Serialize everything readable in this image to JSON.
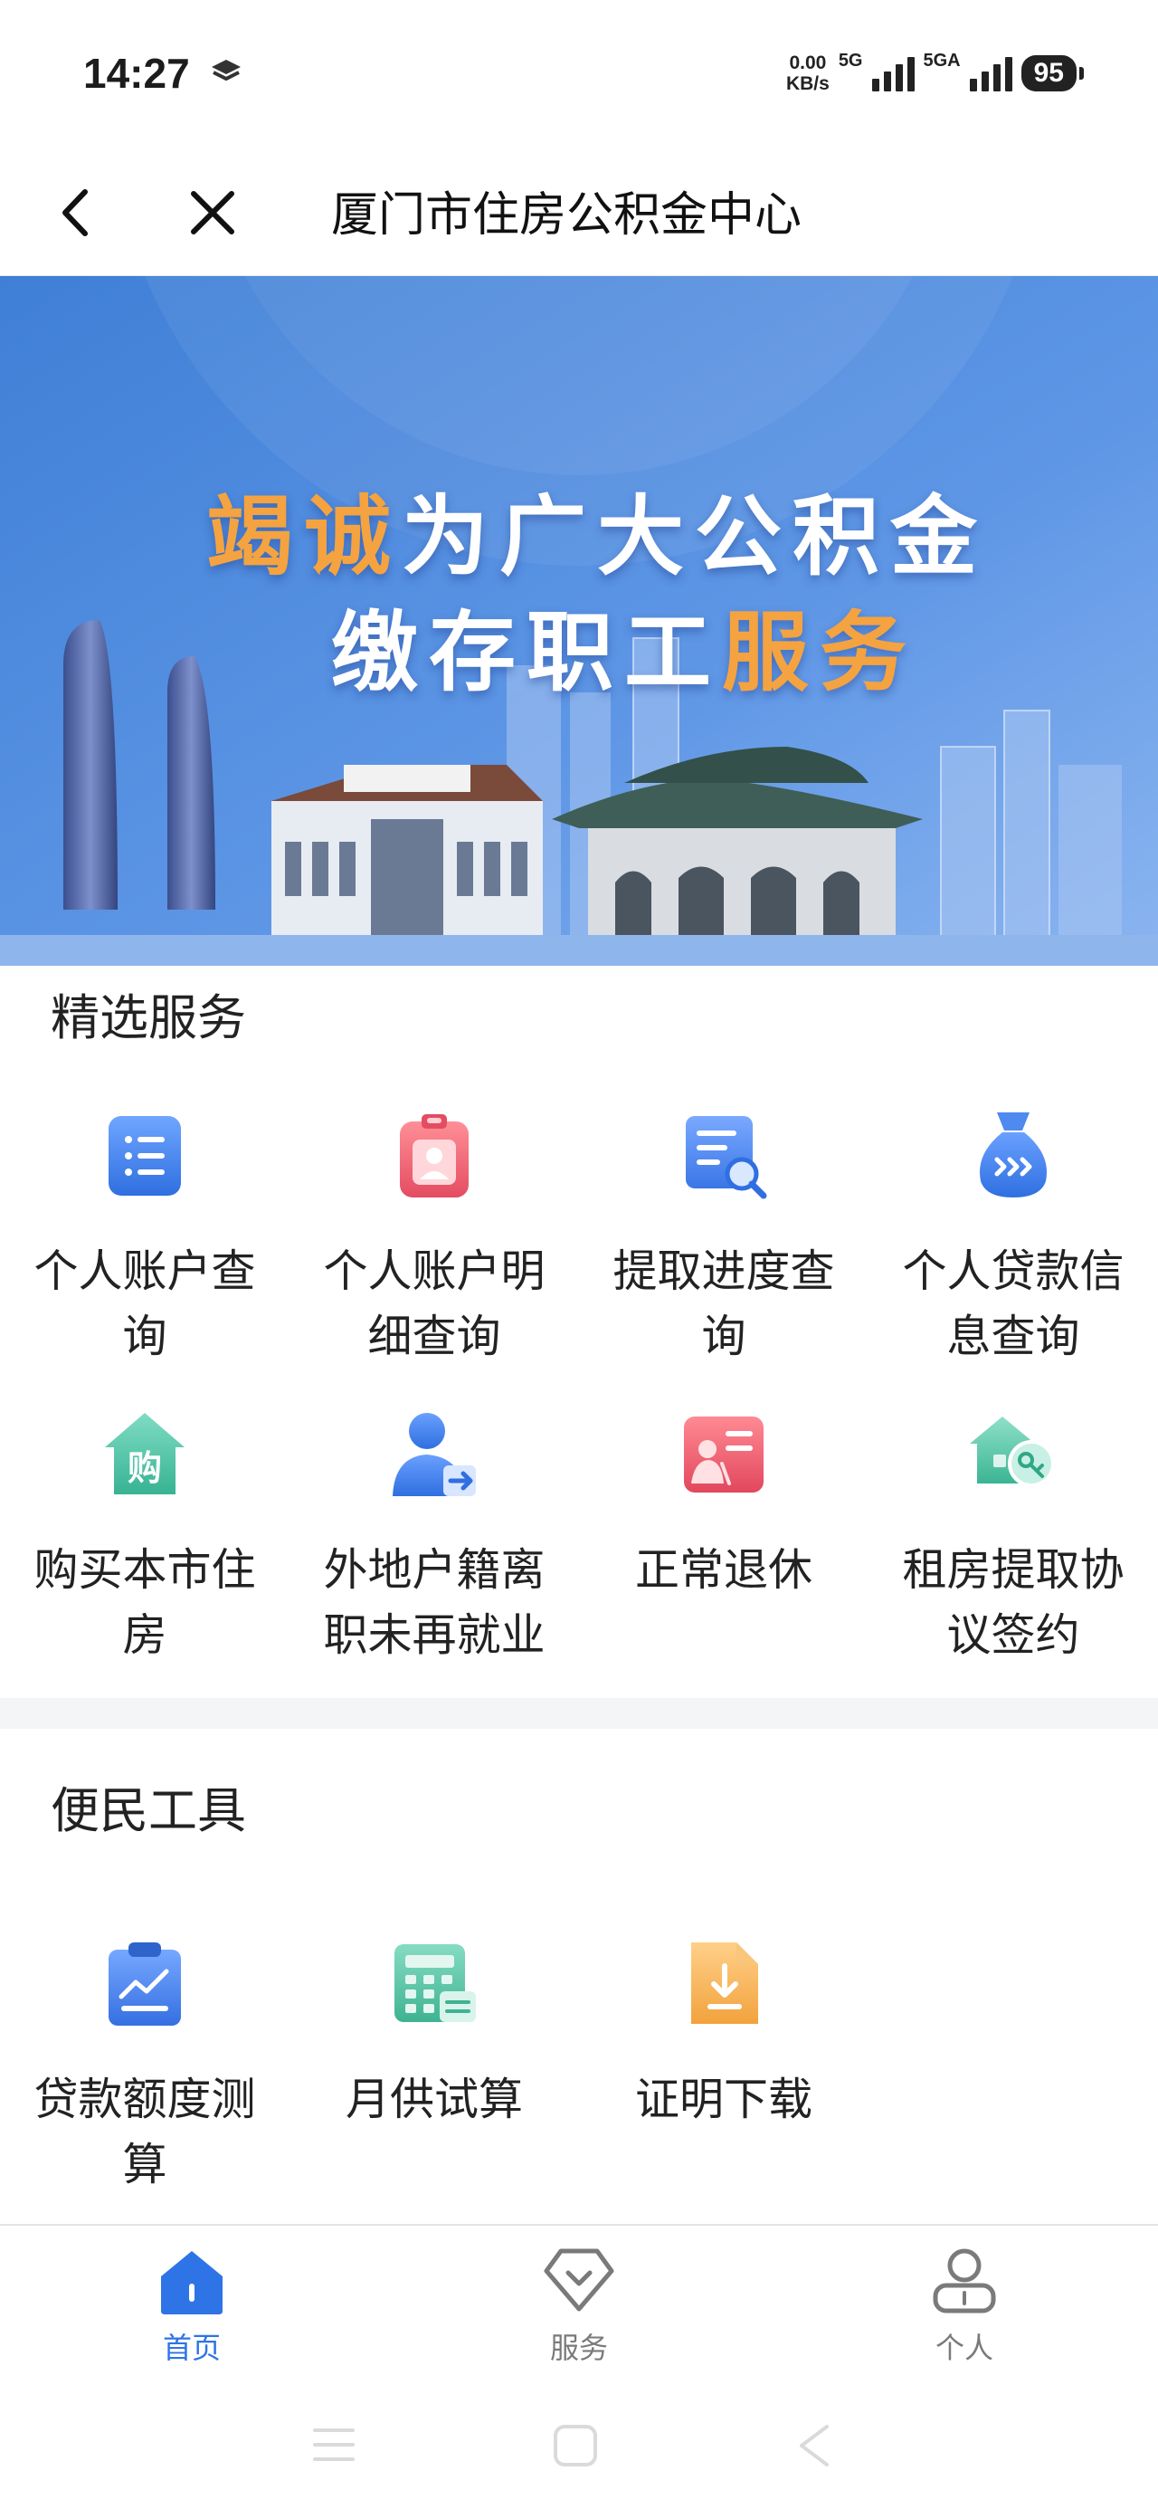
{
  "status_bar": {
    "time": "14:27",
    "net_speed_value": "0.00",
    "net_speed_unit": "KB/s",
    "sim1_label": "5G",
    "sim2_label": "5GA",
    "battery": "95"
  },
  "nav": {
    "title": "厦门市住房公积金中心"
  },
  "banner": {
    "line1_orange": "竭诚",
    "line1_white": "为广大公积金",
    "line2_white": "缴存职工",
    "line2_orange": "服务"
  },
  "featured": {
    "title": "精选服务",
    "items": [
      {
        "label": "个人账户查询",
        "icon": "list-document-icon"
      },
      {
        "label": "个人账户明细查询",
        "icon": "id-badge-icon"
      },
      {
        "label": "提取进度查询",
        "icon": "document-search-icon"
      },
      {
        "label": "个人贷款信息查询",
        "icon": "money-bag-icon"
      },
      {
        "label": "购买本市住房",
        "icon": "house-buy-icon"
      },
      {
        "label": "外地户籍离职未再就业",
        "icon": "user-exit-icon"
      },
      {
        "label": "正常退休",
        "icon": "retirement-card-icon"
      },
      {
        "label": "租房提取协议签约",
        "icon": "house-key-icon"
      }
    ]
  },
  "tools": {
    "title": "便民工具",
    "items": [
      {
        "label": "贷款额度测算",
        "icon": "clipboard-chart-icon"
      },
      {
        "label": "月供试算",
        "icon": "calculator-icon"
      },
      {
        "label": "证明下载",
        "icon": "file-download-icon"
      }
    ]
  },
  "tabbar": {
    "tabs": [
      {
        "label": "首页",
        "icon": "home-icon",
        "active": true
      },
      {
        "label": "服务",
        "icon": "service-diamond-icon",
        "active": false
      },
      {
        "label": "个人",
        "icon": "user-icon",
        "active": false
      }
    ]
  },
  "colors": {
    "accent_blue": "#2f74e6",
    "banner_orange": "#f4a340",
    "inactive_gray": "#7a7a7a"
  }
}
